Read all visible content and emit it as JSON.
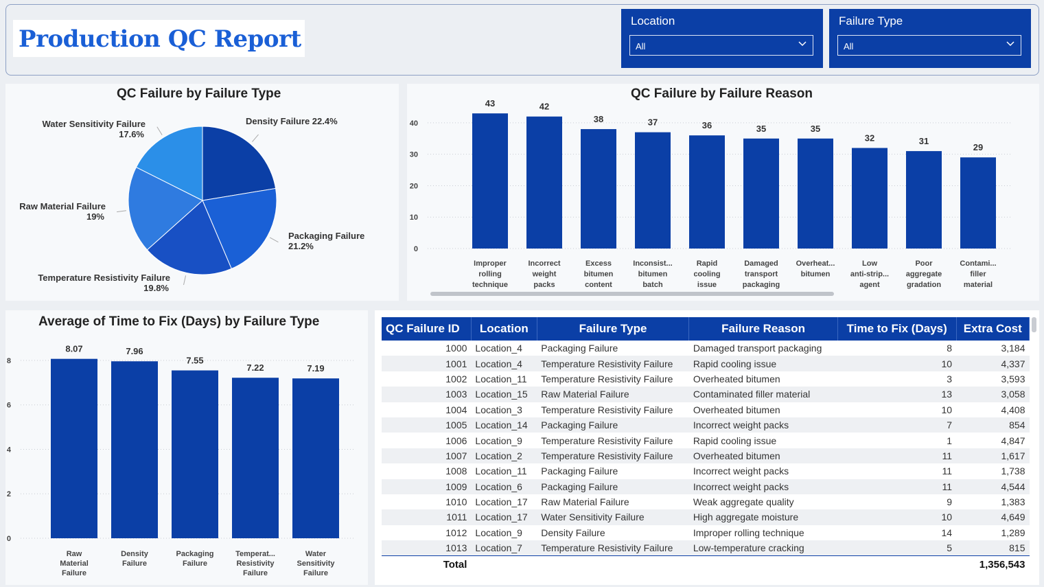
{
  "header": {
    "title": "Production QC Report",
    "slicers": [
      {
        "label": "Location",
        "value": "All"
      },
      {
        "label": "Failure Type",
        "value": "All"
      }
    ]
  },
  "colors": {
    "primary": "#0b3fa6",
    "title": "#1a5fd6",
    "pie": [
      "#0b3fa6",
      "#1a60d6",
      "#1850c4",
      "#2f7be0",
      "#2b8fe8"
    ]
  },
  "pie_chart": {
    "title": "QC Failure by Failure Type",
    "slices": [
      {
        "label": "Density Failure",
        "pct": "22.4%",
        "value": 22.4
      },
      {
        "label": "Packaging Failure",
        "pct": "21.2%",
        "value": 21.2
      },
      {
        "label": "Temperature Resistivity Failure",
        "pct": "19.8%",
        "value": 19.8
      },
      {
        "label": "Raw Material Failure",
        "pct": "19%",
        "value": 19.0
      },
      {
        "label": "Water Sensitivity Failure",
        "pct": "17.6%",
        "value": 17.6
      }
    ]
  },
  "chart_data": [
    {
      "type": "pie",
      "title": "QC Failure by Failure Type",
      "categories": [
        "Density Failure",
        "Packaging Failure",
        "Temperature Resistivity Failure",
        "Raw Material Failure",
        "Water Sensitivity Failure"
      ],
      "values": [
        22.4,
        21.2,
        19.8,
        19.0,
        17.6
      ]
    },
    {
      "type": "bar",
      "title": "QC Failure by Failure Reason",
      "categories": [
        [
          "Improper",
          "rolling",
          "technique"
        ],
        [
          "Incorrect",
          "weight",
          "packs"
        ],
        [
          "Excess",
          "bitumen",
          "content"
        ],
        [
          "Inconsist...",
          "bitumen",
          "batch"
        ],
        [
          "Rapid",
          "cooling",
          "issue"
        ],
        [
          "Damaged",
          "transport",
          "packaging"
        ],
        [
          "Overheat...",
          "bitumen"
        ],
        [
          "Low",
          "anti-strip...",
          "agent"
        ],
        [
          "Poor",
          "aggregate",
          "gradation"
        ],
        [
          "Contami...",
          "filler",
          "material"
        ]
      ],
      "values": [
        43,
        42,
        38,
        37,
        36,
        35,
        35,
        32,
        31,
        29
      ],
      "yticks": [
        0,
        10,
        20,
        30,
        40
      ],
      "ylim": [
        0,
        45
      ]
    },
    {
      "type": "bar",
      "title": "Average of Time to Fix (Days) by Failure Type",
      "categories": [
        [
          "Raw",
          "Material",
          "Failure"
        ],
        [
          "Density",
          "Failure"
        ],
        [
          "Packaging",
          "Failure"
        ],
        [
          "Temperat...",
          "Resistivity",
          "Failure"
        ],
        [
          "Water",
          "Sensitivity",
          "Failure"
        ]
      ],
      "values": [
        8.07,
        7.96,
        7.55,
        7.22,
        7.19
      ],
      "value_labels": [
        "8.07",
        "7.96",
        "7.55",
        "7.22",
        "7.19"
      ],
      "yticks": [
        0,
        2,
        4,
        6,
        8
      ],
      "ylim": [
        0,
        8.4
      ]
    }
  ],
  "table": {
    "columns": [
      "QC Failure ID",
      "Location",
      "Failure Type",
      "Failure Reason",
      "Time to Fix (Days)",
      "Extra Cost"
    ],
    "rows": [
      [
        "1000",
        "Location_4",
        "Packaging Failure",
        "Damaged transport packaging",
        "8",
        "3,184"
      ],
      [
        "1001",
        "Location_4",
        "Temperature Resistivity Failure",
        "Rapid cooling issue",
        "10",
        "4,337"
      ],
      [
        "1002",
        "Location_11",
        "Temperature Resistivity Failure",
        "Overheated bitumen",
        "3",
        "3,593"
      ],
      [
        "1003",
        "Location_15",
        "Raw Material Failure",
        "Contaminated filler material",
        "13",
        "3,058"
      ],
      [
        "1004",
        "Location_3",
        "Temperature Resistivity Failure",
        "Overheated bitumen",
        "10",
        "4,408"
      ],
      [
        "1005",
        "Location_14",
        "Packaging Failure",
        "Incorrect weight packs",
        "7",
        "854"
      ],
      [
        "1006",
        "Location_9",
        "Temperature Resistivity Failure",
        "Rapid cooling issue",
        "1",
        "4,847"
      ],
      [
        "1007",
        "Location_2",
        "Temperature Resistivity Failure",
        "Overheated bitumen",
        "11",
        "1,617"
      ],
      [
        "1008",
        "Location_11",
        "Packaging Failure",
        "Incorrect weight packs",
        "11",
        "1,738"
      ],
      [
        "1009",
        "Location_6",
        "Packaging Failure",
        "Incorrect weight packs",
        "11",
        "4,544"
      ],
      [
        "1010",
        "Location_17",
        "Raw Material Failure",
        "Weak aggregate quality",
        "9",
        "1,383"
      ],
      [
        "1011",
        "Location_17",
        "Water Sensitivity Failure",
        "High aggregate moisture",
        "10",
        "4,649"
      ],
      [
        "1012",
        "Location_9",
        "Density Failure",
        "Improper rolling technique",
        "14",
        "1,289"
      ],
      [
        "1013",
        "Location_7",
        "Temperature Resistivity Failure",
        "Low-temperature cracking",
        "5",
        "815"
      ]
    ],
    "total_label": "Total",
    "total_value": "1,356,543"
  }
}
